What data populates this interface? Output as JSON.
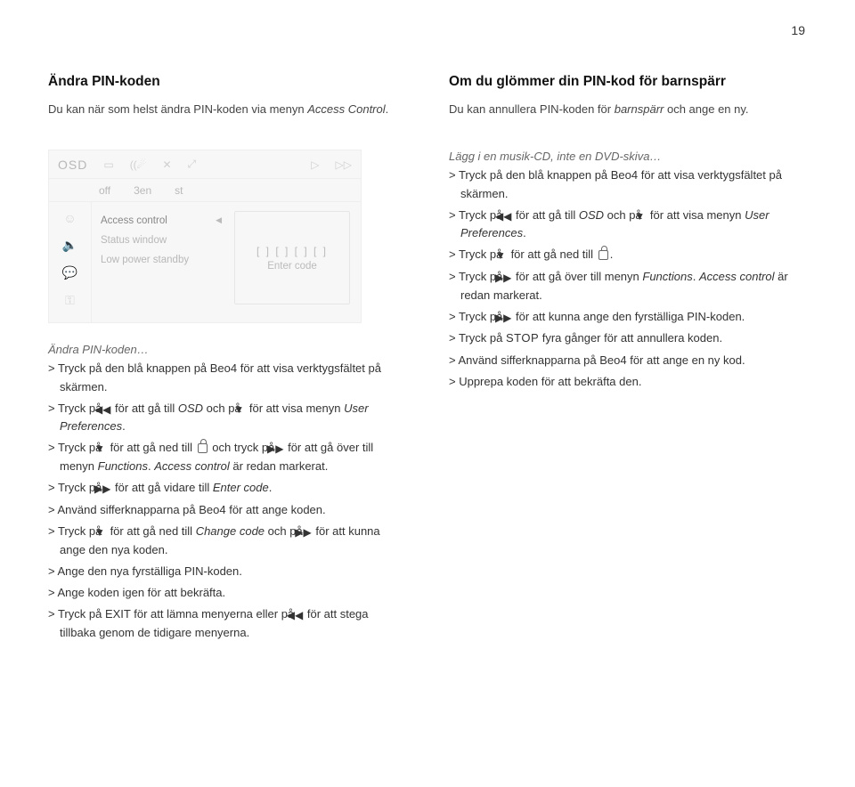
{
  "page_number": "19",
  "left": {
    "title": "Ändra PIN-koden",
    "intro_a": "Du kan när som helst ändra PIN-koden via menyn ",
    "intro_em": "Access Control",
    "intro_b": "."
  },
  "right_top": {
    "title": "Om du glömmer din PIN-kod för barnspärr",
    "intro_a": "Du kan annullera PIN-koden för ",
    "intro_em": "barnspärr",
    "intro_b": " och ange en ny."
  },
  "osd": {
    "title": "OSD",
    "row2": {
      "off": "off",
      "lang": "3en",
      "st": "st"
    },
    "items": {
      "access": "Access control",
      "status": "Status window",
      "standby": "Low power standby"
    },
    "code_slots": "[ ]  [ ]  [ ]  [ ]",
    "enter_code": "Enter code"
  },
  "left_steps": {
    "head": "Ändra PIN-koden…",
    "s1": "> Tryck på den blå knappen på Beo4 för att visa verktygsfältet på skärmen.",
    "s2a": "> Tryck på ",
    "s2b": " för att gå till ",
    "s2c": "OSD",
    "s2d": " och på ",
    "s2e": " för att visa menyn ",
    "s2f": "User Preferences",
    "s2g": ".",
    "s3a": "> Tryck på ",
    "s3b": " för att gå ned till ",
    "s3c": " och tryck på ",
    "s3d": " för att gå över till menyn ",
    "s3e": "Functions",
    "s3f": ". ",
    "s3g": "Access control",
    "s3h": " är redan markerat.",
    "s4a": "> Tryck på ",
    "s4b": " för att gå vidare till ",
    "s4c": "Enter code",
    "s4d": ".",
    "s5": "> Använd sifferknapparna på Beo4 för att ange koden.",
    "s6a": "> Tryck på ",
    "s6b": " för att gå ned till ",
    "s6c": "Change code",
    "s6d": " och på ",
    "s6e": " för att kunna ange den nya koden.",
    "s7": "> Ange den nya fyrställiga PIN-koden.",
    "s8": "> Ange koden igen för att bekräfta.",
    "s9a": "> Tryck på ",
    "s9b": "EXIT",
    "s9c": " för att lämna menyerna eller på ",
    "s9d": " för att stega tillbaka genom de tidigare menyerna."
  },
  "right_steps": {
    "head": "Lägg i en musik-CD, inte en DVD-skiva…",
    "r1": "> Tryck på den blå knappen på Beo4 för att visa verktygsfältet på skärmen.",
    "r2a": "> Tryck på ",
    "r2b": " för att gå till ",
    "r2c": "OSD",
    "r2d": " och på ",
    "r2e": " för att visa menyn ",
    "r2f": "User Preferences",
    "r2g": ".",
    "r3a": "> Tryck på ",
    "r3b": " för att gå ned till ",
    "r3c": ".",
    "r4a": "> Tryck på ",
    "r4b": " för att gå över till menyn ",
    "r4c": "Functions",
    "r4d": ". ",
    "r4e": "Access control",
    "r4f": " är redan markerat.",
    "r5a": "> Tryck på ",
    "r5b": " för att kunna ange den fyrställiga PIN-koden.",
    "r6a": "> Tryck på ",
    "r6b": "STOP",
    "r6c": " fyra gånger för att annullera koden.",
    "r7": "> Använd sifferknapparna på Beo4 för att ange en ny kod.",
    "r8": "> Upprepa koden för att bekräfta den."
  }
}
